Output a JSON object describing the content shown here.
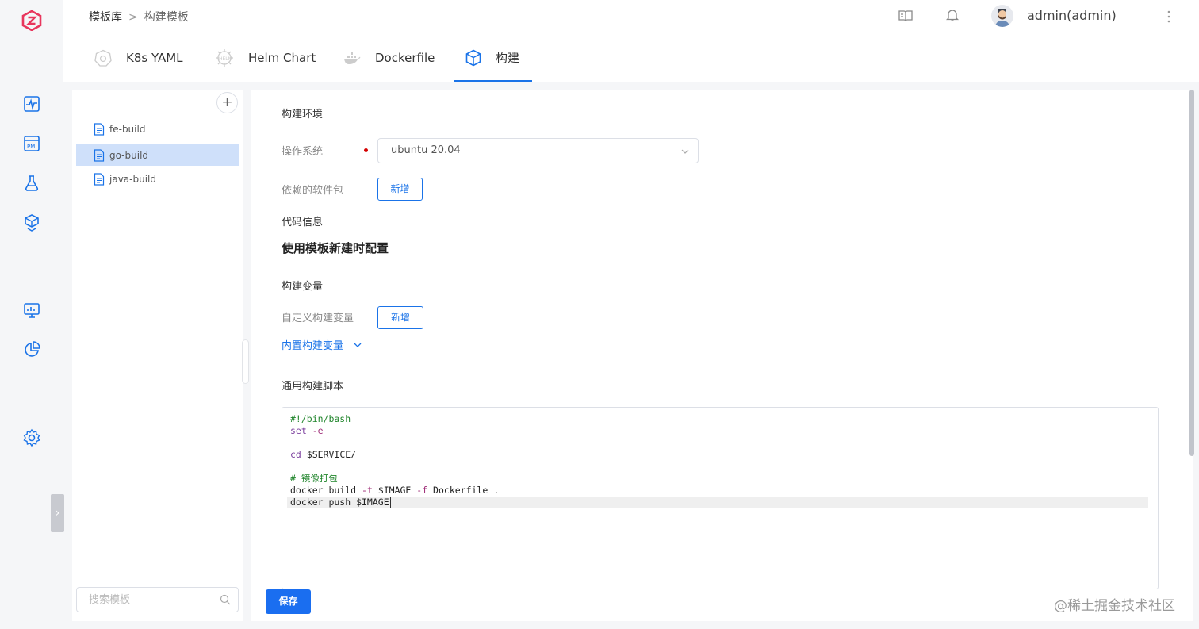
{
  "brand": {
    "accent": "#1a73e8",
    "logo_color": "#e8365d"
  },
  "breadcrumb": {
    "root": "模板库",
    "separator": ">",
    "current": "构建模板"
  },
  "header": {
    "user": "admin(admin)"
  },
  "tabs": [
    {
      "label": "K8s YAML",
      "icon": "k8s-icon"
    },
    {
      "label": "Helm Chart",
      "icon": "helm-icon"
    },
    {
      "label": "Dockerfile",
      "icon": "docker-icon"
    },
    {
      "label": "构建",
      "icon": "cube-icon",
      "active": true
    }
  ],
  "sidebar_rail": [
    "monitor-icon",
    "pm-icon",
    "flask-icon",
    "package-icon",
    "dashboard-icon",
    "pie-chart-icon",
    "settings-icon"
  ],
  "templates": {
    "items": [
      "fe-build",
      "go-build",
      "java-build"
    ],
    "selected": "go-build",
    "search_placeholder": "搜索模板"
  },
  "form": {
    "env_title": "构建环境",
    "os_label": "操作系统",
    "os_value": "ubuntu 20.04",
    "deps_label": "依赖的软件包",
    "add_label": "新增",
    "code_title": "代码信息",
    "code_note": "使用模板新建时配置",
    "vars_title": "构建变量",
    "custom_vars_label": "自定义构建变量",
    "add_label2": "新增",
    "builtin_vars_link": "内置构建变量",
    "script_title": "通用构建脚本",
    "save_label": "保存"
  },
  "script": {
    "line1": "#!/bin/bash",
    "line2a": "set",
    "line2b": " -e",
    "line4a": "cd",
    "line4b": " $SERVICE/",
    "line6": "# 镜像打包",
    "line7a": "docker build ",
    "line7b": "-t",
    "line7c": " $IMAGE ",
    "line7d": "-f",
    "line7e": " Dockerfile .",
    "line8": "docker push $IMAGE"
  },
  "watermark": "@稀土掘金技术社区"
}
